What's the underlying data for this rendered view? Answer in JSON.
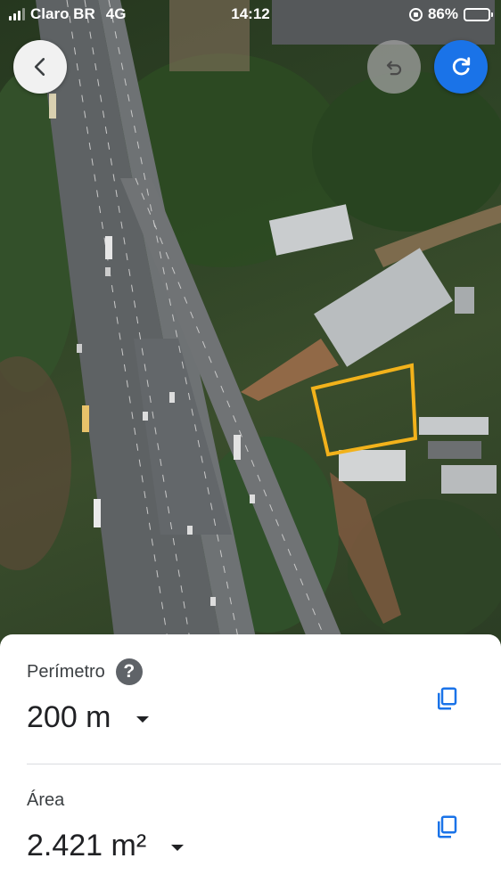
{
  "status_bar": {
    "carrier": "Claro BR",
    "network": "4G",
    "time": "14:12",
    "battery": "86%",
    "battery_level": 0.86
  },
  "map": {
    "boundary_color": "#f2b21b"
  },
  "buttons": {
    "back_icon": "arrow-back-icon",
    "undo_icon": "undo-icon",
    "redo_icon": "redo-icon",
    "redo_color": "#1a73e8"
  },
  "measurement": {
    "perimeter": {
      "label": "Perímetro",
      "help": "?",
      "value": "200 m"
    },
    "area": {
      "label": "Área",
      "value": "2.421 m²"
    }
  }
}
